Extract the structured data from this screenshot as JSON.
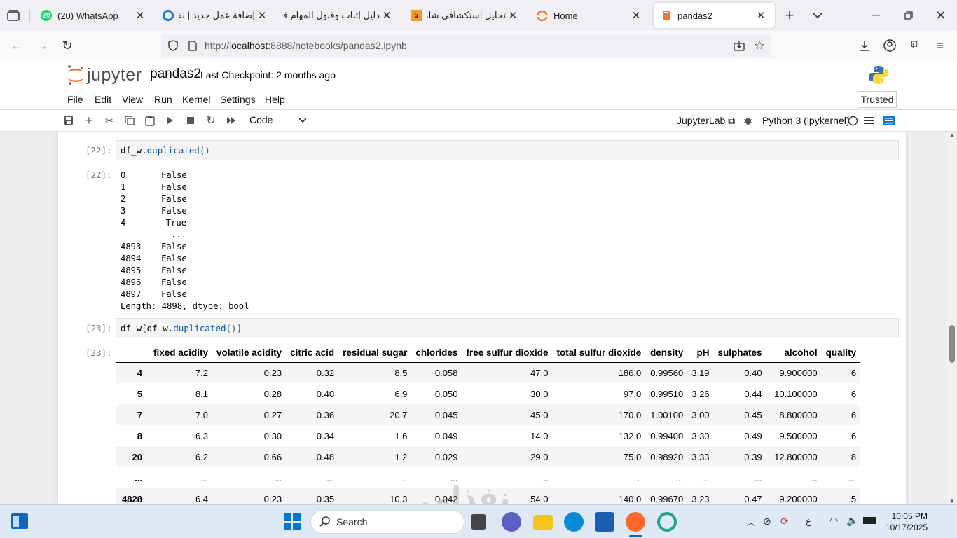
{
  "browser": {
    "tabs": [
      {
        "title": "(20) WhatsApp",
        "badge": "20"
      },
      {
        "title": "إضافة عمل جديد | نفذلي"
      },
      {
        "title": "دليل إثبات وقبول المهام في"
      },
      {
        "title": "تحليل استكشافي شامل",
        "badge": "5"
      },
      {
        "title": "Home"
      },
      {
        "title": "pandas2"
      }
    ],
    "url_prefix": "http://",
    "url_host": "localhost",
    "url_rest": ":8888/notebooks/pandas2.ipynb"
  },
  "jupyter": {
    "logo_text": "jupyter",
    "notebook_name": "pandas2",
    "checkpoint": "Last Checkpoint: 2 months ago",
    "menus": [
      "File",
      "Edit",
      "View",
      "Run",
      "Kernel",
      "Settings",
      "Help"
    ],
    "trusted": "Trusted",
    "cell_type": "Code",
    "jupyterlab_link": "JupyterLab",
    "kernel": "Python 3 (ipykernel)"
  },
  "cells": {
    "cell22": {
      "prompt_in": "[22]:",
      "prompt_out": "[22]:",
      "code_obj": "df_w.",
      "code_fn": "duplicated",
      "code_args": "()",
      "output": [
        {
          "idx": "0",
          "val": "False"
        },
        {
          "idx": "1",
          "val": "False"
        },
        {
          "idx": "2",
          "val": "False"
        },
        {
          "idx": "3",
          "val": "False"
        },
        {
          "idx": "4",
          "val": "True"
        },
        {
          "idx": "",
          "val": "..."
        },
        {
          "idx": "4893",
          "val": "False"
        },
        {
          "idx": "4894",
          "val": "False"
        },
        {
          "idx": "4895",
          "val": "False"
        },
        {
          "idx": "4896",
          "val": "False"
        },
        {
          "idx": "4897",
          "val": "False"
        }
      ],
      "footer": "Length: 4898, dtype: bool"
    },
    "cell23": {
      "prompt_in": "[23]:",
      "prompt_out": "[23]:",
      "code_obj": "df_w[df_w.",
      "code_fn": "duplicated",
      "code_args": "()]",
      "columns": [
        "",
        "fixed acidity",
        "volatile acidity",
        "citric acid",
        "residual sugar",
        "chlorides",
        "free sulfur dioxide",
        "total sulfur dioxide",
        "density",
        "pH",
        "sulphates",
        "alcohol",
        "quality"
      ],
      "rows": [
        [
          "4",
          "7.2",
          "0.23",
          "0.32",
          "8.5",
          "0.058",
          "47.0",
          "186.0",
          "0.99560",
          "3.19",
          "0.40",
          "9.900000",
          "6"
        ],
        [
          "5",
          "8.1",
          "0.28",
          "0.40",
          "6.9",
          "0.050",
          "30.0",
          "97.0",
          "0.99510",
          "3.26",
          "0.44",
          "10.100000",
          "6"
        ],
        [
          "7",
          "7.0",
          "0.27",
          "0.36",
          "20.7",
          "0.045",
          "45.0",
          "170.0",
          "1.00100",
          "3.00",
          "0.45",
          "8.800000",
          "6"
        ],
        [
          "8",
          "6.3",
          "0.30",
          "0.34",
          "1.6",
          "0.049",
          "14.0",
          "132.0",
          "0.99400",
          "3.30",
          "0.49",
          "9.500000",
          "6"
        ],
        [
          "20",
          "6.2",
          "0.66",
          "0.48",
          "1.2",
          "0.029",
          "29.0",
          "75.0",
          "0.98920",
          "3.33",
          "0.39",
          "12.800000",
          "8"
        ],
        [
          "...",
          "...",
          "...",
          "...",
          "...",
          "...",
          "...",
          "...",
          "...",
          "...",
          "...",
          "...",
          "..."
        ],
        [
          "4828",
          "6.4",
          "0.23",
          "0.35",
          "10.3",
          "0.042",
          "54.0",
          "140.0",
          "0.99670",
          "3.23",
          "0.47",
          "9.200000",
          "5"
        ]
      ]
    }
  },
  "watermark": "نفذلي",
  "taskbar": {
    "search_label": "Search",
    "time": "10:05 PM",
    "date": "10/17/2025",
    "lang": "ع"
  },
  "colors": {
    "jupyter_orange": "#f37726",
    "whatsapp": "#25d366",
    "firefox_accent": "#0060df"
  }
}
